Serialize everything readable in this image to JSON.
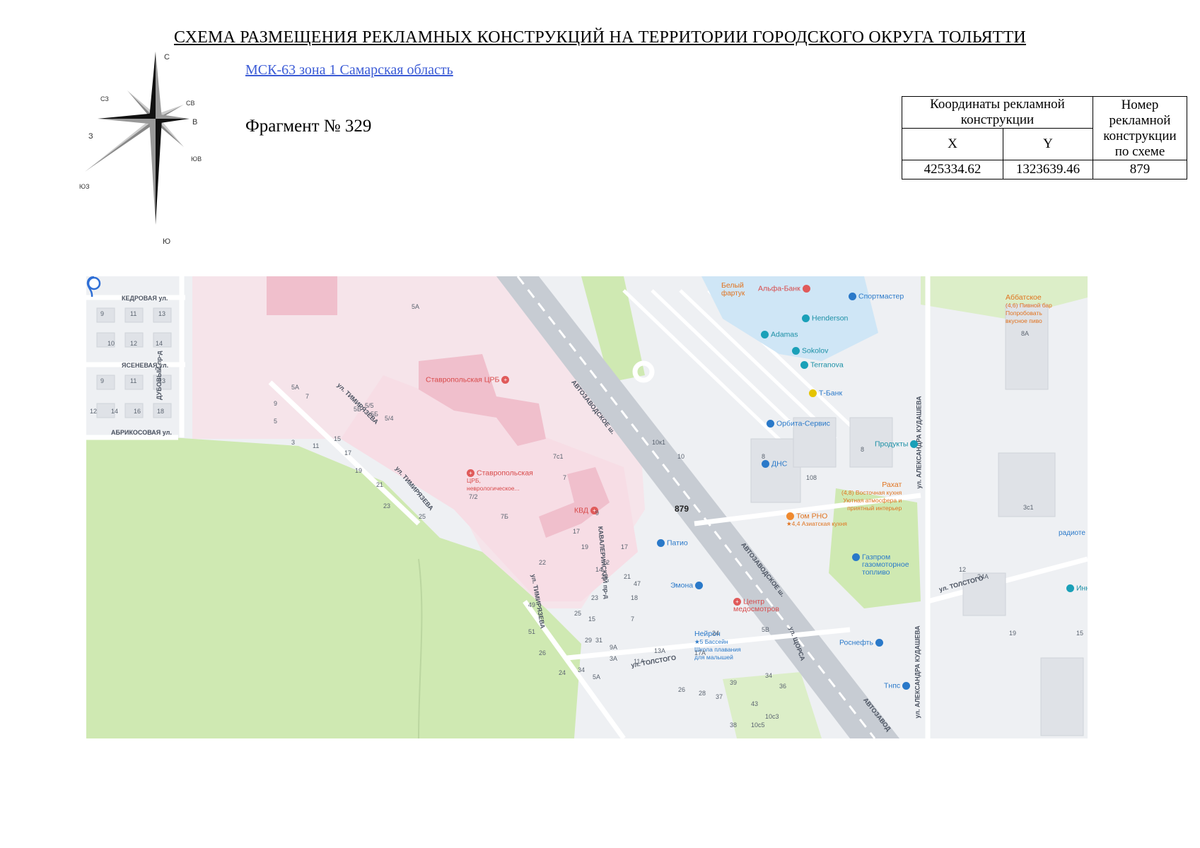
{
  "document": {
    "title": "СХЕМА РАЗМЕЩЕНИЯ РЕКЛАМНЫХ КОНСТРУКЦИЙ НА ТЕРРИТОРИИ ГОРОДСКОГО ОКРУГА ТОЛЬЯТТИ",
    "crs": "МСК-63 зона 1 Самарская область",
    "fragment": "Фрагмент № 329"
  },
  "compass": {
    "n": "С",
    "ne": "СВ",
    "e": "В",
    "se": "ЮВ",
    "s": "Ю",
    "sw": "ЮЗ",
    "w": "З",
    "nw": "СЗ"
  },
  "table": {
    "header_coords": "Координаты рекламной конструкции",
    "header_number": "Номер рекламной конструкции по схеме",
    "col_x": "X",
    "col_y": "Y",
    "rows": [
      {
        "x": "425334.62",
        "y": "1323639.46",
        "number": "879"
      }
    ]
  },
  "map": {
    "marker_label": "879",
    "roads": {
      "kedrovaya": "КЕДРОВАЯ ул.",
      "yasenevaya": "ЯСЕНЕВАЯ ул.",
      "abrikosovaya": "АБРИКОСОВАЯ ул.",
      "dubovy": "ДУБОВЫЙ пр-д",
      "timiryazeva1": "ул. ТИМИРЯЗЕВА",
      "timiryazeva2": "ул. ТИМИРЯЗЕВА",
      "timiryazeva3": "ул. ТИМИРЯЗЕВА",
      "avtozavodskoe1": "АВТОЗАВОДСКОЕ ш.",
      "avtozavodskoe2": "АВТОЗАВОДСКОЕ ш.",
      "avtozavodskoe3": "АВТОЗАВОД",
      "kudasheva1": "ул. АЛЕКСАНДРА КУДАШЕВА",
      "kudasheva2": "ул. АЛЕКСАНДРА КУДАШЕВА",
      "tolstogo1": "ул. ТОЛСТОГО",
      "tolstogo2": "ул. ТОЛСТОГО",
      "kavaleriysky": "КАВАЛЕРИЙСКИЙ пр-д",
      "shchorsa": "ул. ЩОРСА"
    },
    "pois": {
      "stavropol_crb": "Ставропольская ЦРБ",
      "stavropol_crb_neuro_1": "Ставропольская",
      "stavropol_crb_neuro_2": "ЦРБ,",
      "stavropol_crb_neuro_3": "неврологическое...",
      "kvd": "КВД",
      "patio": "Патио",
      "emona": "Эмона",
      "center_1": "Центр",
      "center_2": "медосмотров",
      "neiron": "Нейрон",
      "neiron_sub_1": "★5 Бассейн",
      "neiron_sub_2": "Школа плавания",
      "neiron_sub_3": "для малышей",
      "rosneft": "Роснефть",
      "tnps": "Тнпс",
      "gazprom_1": "Газпром",
      "gazprom_2": "газомоторное",
      "gazprom_3": "топливо",
      "tom_rno": "Том РНО",
      "tom_rno_sub": "★4,4 Азиатская кухня",
      "rakhat": "Рахат",
      "rakhat_sub_1": "(4,8) Восточная кухня",
      "rakhat_sub_2": "Уютная атмосфера и",
      "rakhat_sub_3": "приятный интерьер",
      "produkty": "Продукты",
      "dns": "ДНС",
      "orbita": "Орбита-Сервис",
      "tbank": "Т-Банк",
      "terranova": "Terranova",
      "sokolov": "Sokolov",
      "adamas": "Adamas",
      "henderson": "Henderson",
      "sportmaster": "Спортмастер",
      "alfabank": "Альфа-Банк",
      "bely_fartuk_1": "Белый",
      "bely_fartuk_2": "фартук",
      "abbatskoe": "Аббатское",
      "abbatskoe_sub_1": "(4,6) Пивной бар",
      "abbatskoe_sub_2": "Попробовать",
      "abbatskoe_sub_3": "вкусное пиво",
      "radiote": "радиоте",
      "inn": "Инн"
    },
    "house_numbers": [
      "9",
      "11",
      "13",
      "10",
      "12",
      "14",
      "9",
      "11",
      "13",
      "12",
      "14",
      "16",
      "18",
      "5А",
      "7",
      "9",
      "5",
      "3",
      "11",
      "15",
      "17",
      "19",
      "21",
      "23",
      "25",
      "5А",
      "5В",
      "5/5",
      "5Б",
      "5/4",
      "7с1",
      "7",
      "7/2",
      "7Б",
      "9",
      "17",
      "19",
      "12",
      "17",
      "22",
      "14",
      "21",
      "23",
      "25",
      "15",
      "28",
      "18",
      "7",
      "47",
      "49",
      "51",
      "26",
      "24",
      "34",
      "31",
      "29",
      "3А",
      "5А",
      "9А",
      "11А",
      "13А",
      "17А",
      "24",
      "26",
      "28",
      "37",
      "39",
      "43",
      "34",
      "36",
      "38",
      "10с5",
      "10с3",
      "10к1",
      "10",
      "8",
      "108",
      "8",
      "8А",
      "3с1",
      "12",
      "24А",
      "19",
      "15",
      "5В"
    ]
  }
}
